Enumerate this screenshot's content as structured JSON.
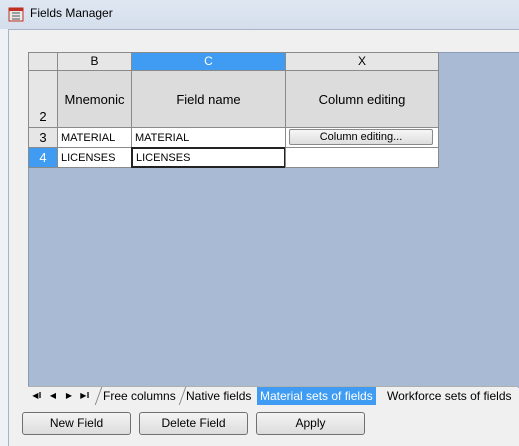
{
  "window": {
    "title": "Fields Manager"
  },
  "grid": {
    "column_headers": [
      "B",
      "C",
      "X"
    ],
    "header_row_number": "2",
    "header_labels": [
      "Mnemonic",
      "Field name",
      "Column editing"
    ],
    "rows": [
      {
        "row_number": "3",
        "mnemonic": "MATERIAL",
        "field_name": "MATERIAL",
        "column_editing_button": "Column editing..."
      },
      {
        "row_number": "4",
        "mnemonic": "LICENSES",
        "field_name": "LICENSES"
      }
    ]
  },
  "tabs": {
    "items": [
      "Free columns",
      "Native fields",
      "Material sets of fields",
      "Workforce sets of fields"
    ],
    "active": "Material sets of fields"
  },
  "buttons": {
    "new_field": "New Field",
    "delete_field": "Delete Field",
    "apply": "Apply"
  },
  "colors": {
    "selection": "#3f9cf2",
    "grid_background": "#a9bbd4"
  }
}
